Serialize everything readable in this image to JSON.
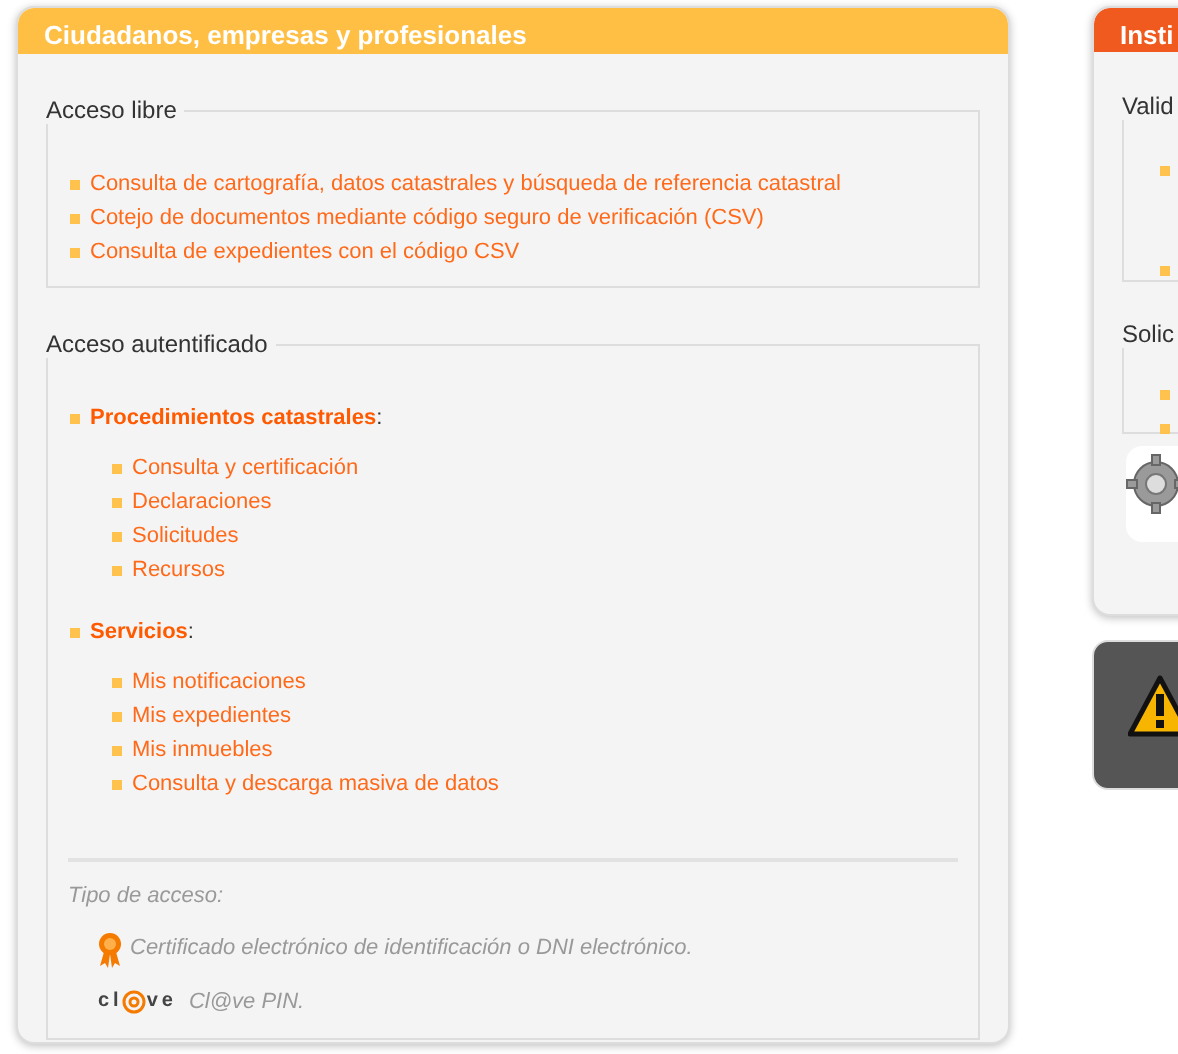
{
  "main_panel": {
    "title": "Ciudadanos, empresas y profesionales",
    "free_access": {
      "legend": "Acceso libre",
      "links": [
        "Consulta de cartografía, datos catastrales y búsqueda de referencia catastral",
        "Cotejo de documentos mediante código seguro de verificación (CSV)",
        "Consulta de expedientes con el código CSV"
      ]
    },
    "authenticated_access": {
      "legend": "Acceso autentificado",
      "groups": [
        {
          "title": "Procedimientos catastrales",
          "suffix": ":",
          "links": [
            "Consulta y certificación",
            "Declaraciones",
            "Solicitudes",
            "Recursos"
          ]
        },
        {
          "title": "Servicios",
          "suffix": ":",
          "links": [
            "Mis notificaciones",
            "Mis expedientes",
            "Mis inmuebles",
            "Consulta y descarga masiva de datos"
          ]
        }
      ]
    },
    "access_types": {
      "label": "Tipo de acceso:",
      "items": [
        {
          "kind": "certificate",
          "text": "Certificado electrónico de identificación o DNI electrónico."
        },
        {
          "kind": "clave",
          "logo_before": "cl",
          "logo_after": "ve",
          "text": "Cl@ve PIN."
        }
      ]
    }
  },
  "side_panel": {
    "title": "Insti",
    "sections": [
      {
        "legend": "Valid"
      },
      {
        "legend": "Solic"
      }
    ]
  }
}
